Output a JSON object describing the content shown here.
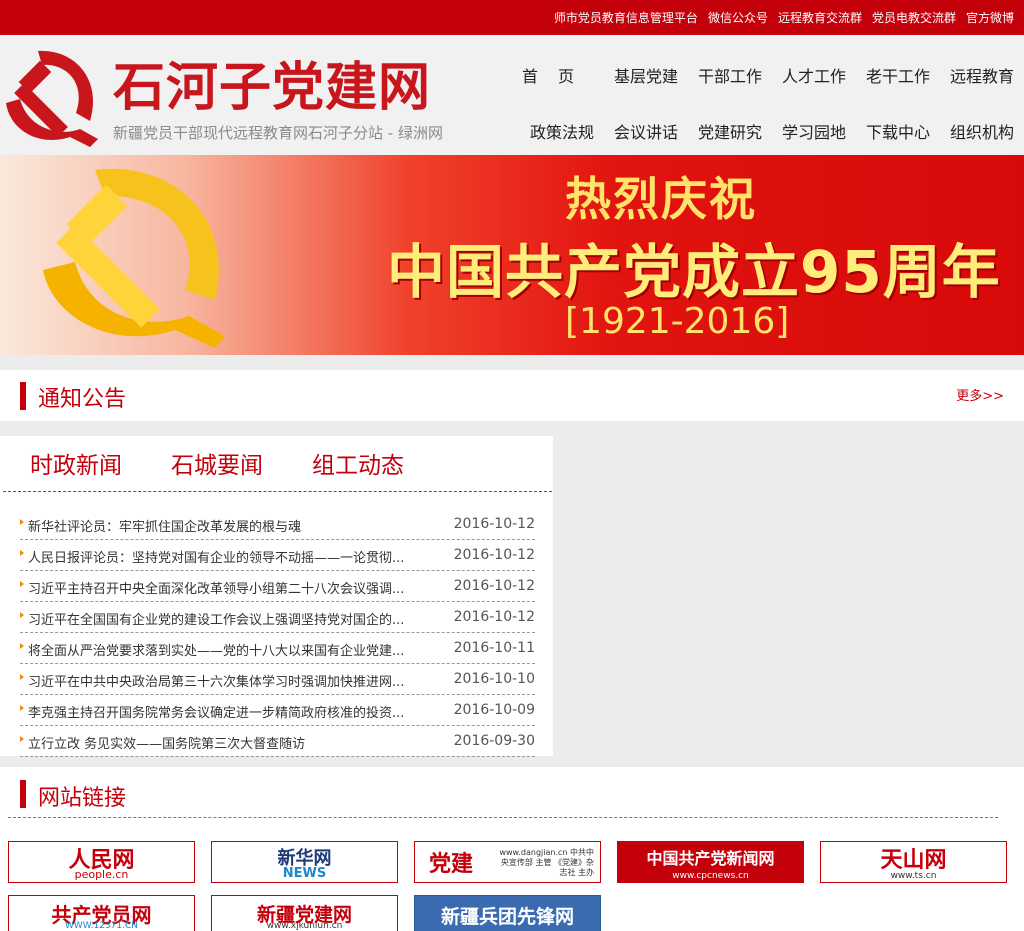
{
  "topbar": {
    "links": [
      "师市党员教育信息管理平台",
      "微信公众号",
      "远程教育交流群",
      "党员电教交流群",
      "官方微博"
    ]
  },
  "header": {
    "site_title": "石河子党建网",
    "subtitle": "新疆党员干部现代远程教育网石河子分站 - 绿洲网",
    "nav_row1": [
      "首页",
      "基层党建",
      "干部工作",
      "人才工作",
      "老干工作",
      "远程教育"
    ],
    "nav_row2": [
      "政策法规",
      "会议讲话",
      "党建研究",
      "学习园地",
      "下载中心",
      "组织机构"
    ]
  },
  "banner": {
    "line1": "热烈庆祝",
    "line2": "中国共产党成立95周年",
    "line3": "[1921-2016]"
  },
  "notice": {
    "title": "通知公告",
    "more": "更多>>"
  },
  "news": {
    "tabs": [
      "时政新闻",
      "石城要闻",
      "组工动态"
    ],
    "items": [
      {
        "title": "新华社评论员：牢牢抓住国企改革发展的根与魂",
        "date": "2016-10-12"
      },
      {
        "title": "人民日报评论员：坚持党对国有企业的领导不动摇——一论贯彻...",
        "date": "2016-10-12"
      },
      {
        "title": "习近平主持召开中央全面深化改革领导小组第二十八次会议强调...",
        "date": "2016-10-12"
      },
      {
        "title": "习近平在全国国有企业党的建设工作会议上强调坚持党对国企的...",
        "date": "2016-10-12"
      },
      {
        "title": "将全面从严治党要求落到实处——党的十八大以来国有企业党建...",
        "date": "2016-10-11"
      },
      {
        "title": "习近平在中共中央政治局第三十六次集体学习时强调加快推进网...",
        "date": "2016-10-10"
      },
      {
        "title": "李克强主持召开国务院常务会议确定进一步精简政府核准的投资...",
        "date": "2016-10-09"
      },
      {
        "title": "立行立改 务见实效——国务院第三次大督查随访",
        "date": "2016-09-30"
      }
    ]
  },
  "site_links": {
    "title": "网站链接",
    "items": [
      {
        "name": "人民网",
        "sub": "people.cn"
      },
      {
        "name": "新华网",
        "sub": "NEWS"
      },
      {
        "name": "党建",
        "sub": "www.dangjian.cn 中共中央宣传部 主管 《党建》杂志社 主办"
      },
      {
        "name": "中国共产党新闻网",
        "sub": "www.cpcnews.cn"
      },
      {
        "name": "天山网",
        "sub": "www.ts.cn"
      },
      {
        "name": "共产党员网",
        "sub": "WWW.12371.CN"
      },
      {
        "name": "新疆党建网",
        "sub": "www.xjkunlun.cn"
      },
      {
        "name": "新疆兵团先锋网",
        "sub": ""
      }
    ]
  },
  "colors": {
    "brand_red": "#c4000b",
    "banner_gold": "#ffe36b",
    "header_bg": "#f1f1f1"
  }
}
